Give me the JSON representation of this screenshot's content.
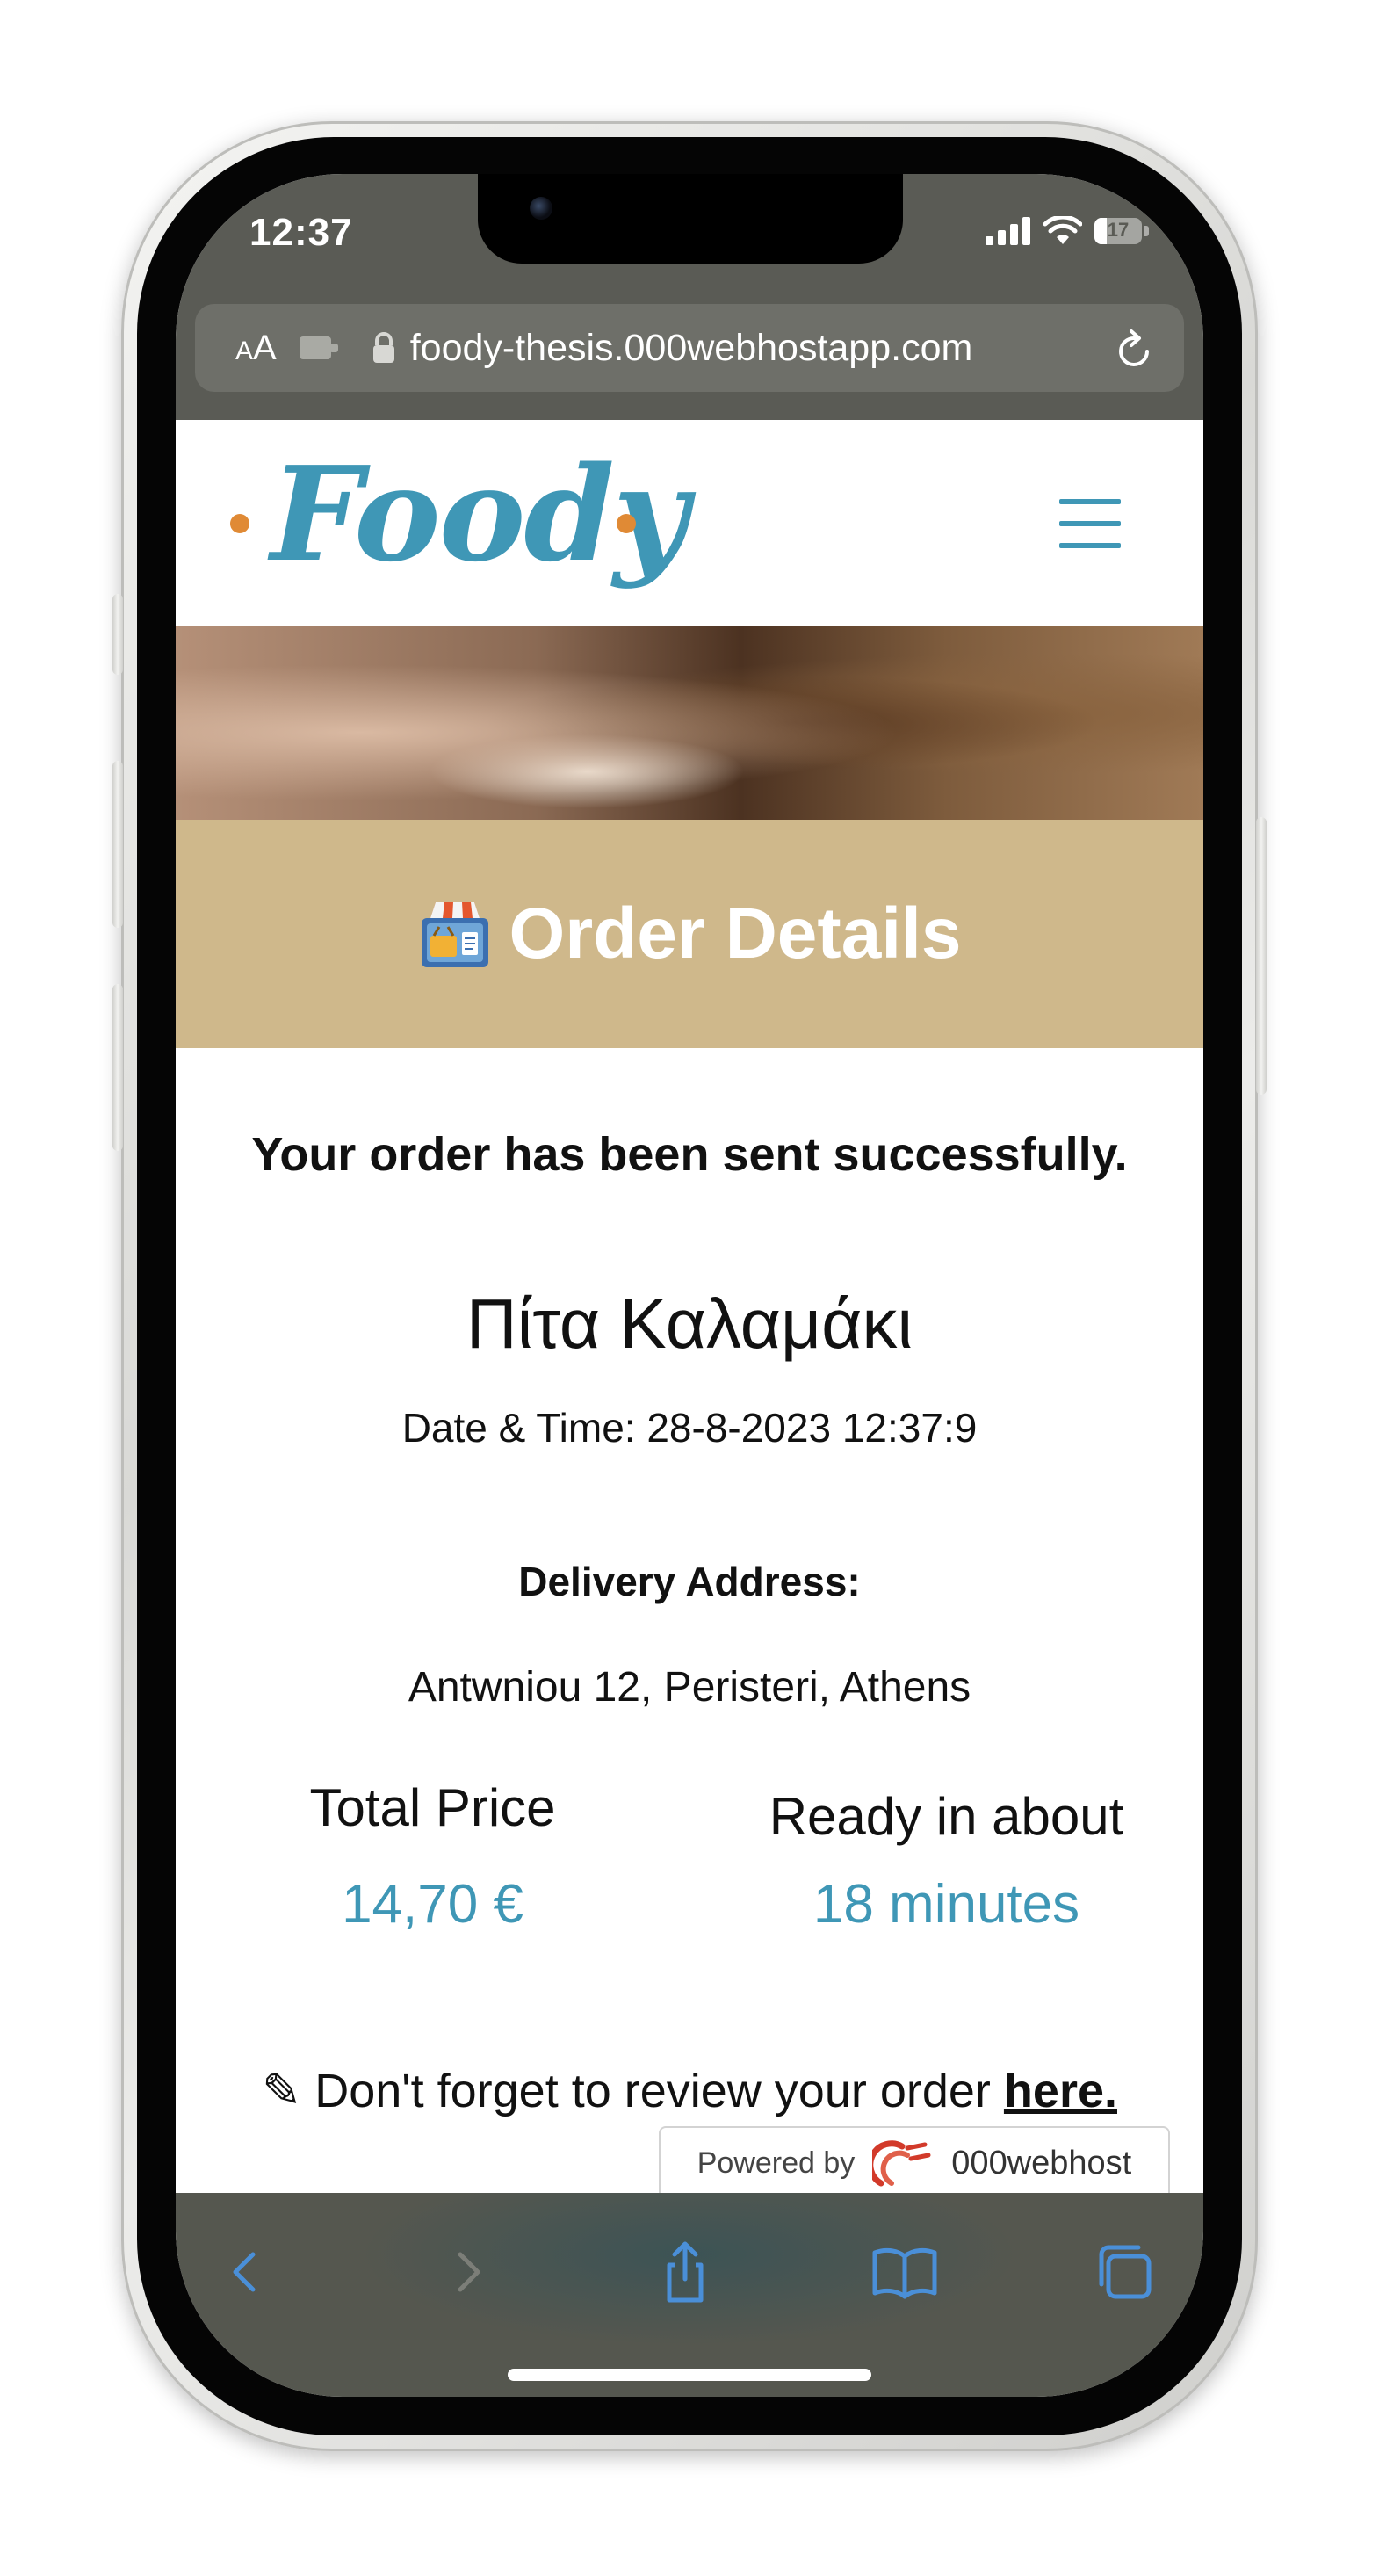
{
  "status_bar": {
    "time": "12:37",
    "battery": "17"
  },
  "browser": {
    "text_size_small": "A",
    "text_size_large": "A",
    "url": "foody-thesis.000webhostapp.com"
  },
  "site": {
    "logo": "Foody",
    "order_title": "Order Details",
    "success_message": "Your order has been sent successfully.",
    "dish_name": "Πίτα Καλαμάκι",
    "datetime": "Date & Time: 28-8-2023 12:37:9",
    "delivery_label": "Delivery Address:",
    "delivery_address": "Antwniou 12, Peristeri, Athens",
    "total_label": "Total Price",
    "total_value": "14,70 €",
    "ready_label": "Ready in about",
    "ready_value": "18 minutes",
    "review_prefix": "✎ Don't forget to review your order ",
    "review_link": "here.",
    "powered_by": "Powered by",
    "host_brand": "000webhost"
  },
  "colors": {
    "brand_blue": "#3f97b6",
    "banner": "#cfb88b",
    "accent_orange": "#e08a35"
  }
}
